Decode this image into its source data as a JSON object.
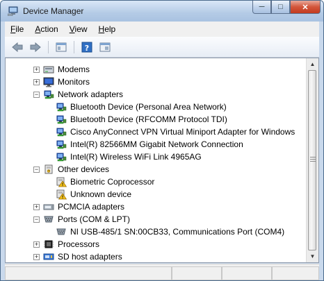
{
  "window": {
    "title": "Device Manager"
  },
  "menu": [
    {
      "label": "File"
    },
    {
      "label": "Action"
    },
    {
      "label": "View"
    },
    {
      "label": "Help"
    }
  ],
  "toolbar": {
    "buttons": [
      {
        "name": "back-arrow-icon"
      },
      {
        "name": "forward-arrow-icon"
      },
      {
        "name": "show-hide-console-tree-icon"
      },
      {
        "name": "help-icon"
      },
      {
        "name": "properties-icon"
      }
    ]
  },
  "tree": [
    {
      "label": "Modems",
      "level": 0,
      "expander": "+",
      "icon": "modem-icon"
    },
    {
      "label": "Monitors",
      "level": 0,
      "expander": "+",
      "icon": "monitor-icon"
    },
    {
      "label": "Network adapters",
      "level": 0,
      "expander": "-",
      "icon": "network-adapter-icon"
    },
    {
      "label": "Bluetooth Device (Personal Area Network)",
      "level": 1,
      "icon": "network-adapter-icon"
    },
    {
      "label": "Bluetooth Device (RFCOMM Protocol TDI)",
      "level": 1,
      "icon": "network-adapter-icon"
    },
    {
      "label": "Cisco AnyConnect VPN Virtual Miniport Adapter for Windows",
      "level": 1,
      "icon": "network-adapter-icon"
    },
    {
      "label": "Intel(R) 82566MM Gigabit Network Connection",
      "level": 1,
      "icon": "network-adapter-icon"
    },
    {
      "label": "Intel(R) Wireless WiFi Link 4965AG",
      "level": 1,
      "icon": "network-adapter-icon"
    },
    {
      "label": "Other devices",
      "level": 0,
      "expander": "-",
      "icon": "other-devices-icon"
    },
    {
      "label": "Biometric Coprocessor",
      "level": 1,
      "icon": "unknown-device-warning-icon"
    },
    {
      "label": "Unknown device",
      "level": 1,
      "icon": "unknown-device-warning-icon"
    },
    {
      "label": "PCMCIA adapters",
      "level": 0,
      "expander": "+",
      "icon": "pcmcia-icon"
    },
    {
      "label": "Ports (COM & LPT)",
      "level": 0,
      "expander": "-",
      "icon": "port-icon"
    },
    {
      "label": "NI USB-485/1 SN:00CB33, Communications Port (COM4)",
      "level": 1,
      "icon": "port-icon"
    },
    {
      "label": "Processors",
      "level": 0,
      "expander": "+",
      "icon": "processor-icon"
    },
    {
      "label": "SD host adapters",
      "level": 0,
      "expander": "+",
      "icon": "sd-host-icon"
    }
  ]
}
